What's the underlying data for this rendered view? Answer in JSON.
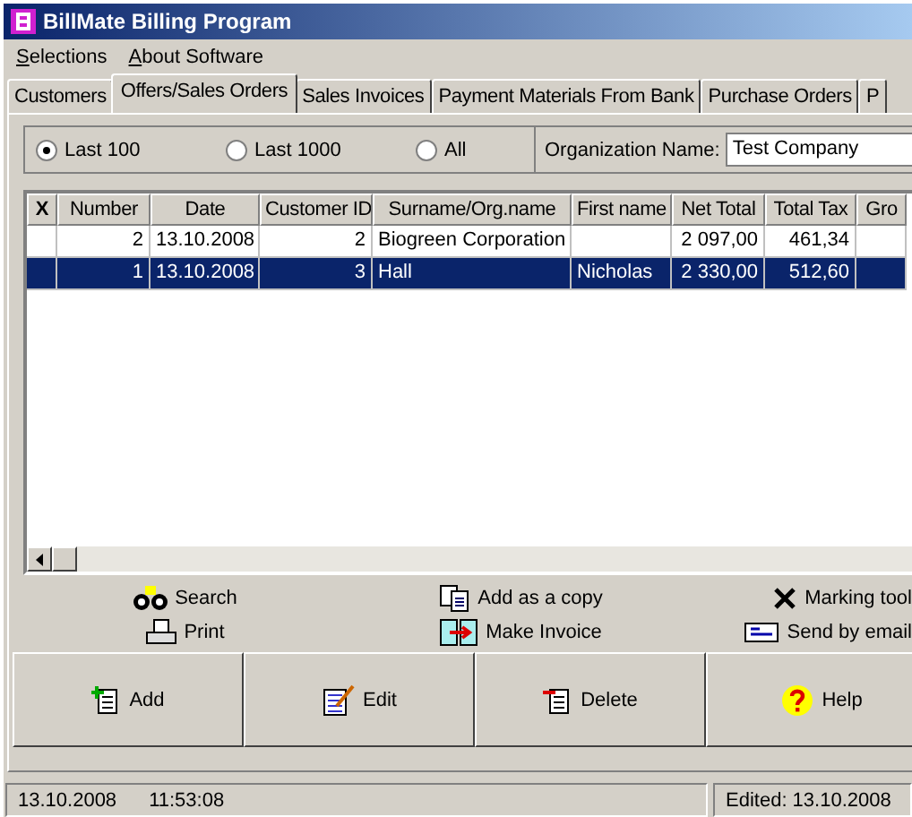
{
  "window": {
    "title": "BillMate Billing Program"
  },
  "menu": [
    {
      "label": "Selections"
    },
    {
      "label": "About Software"
    }
  ],
  "tabs": [
    {
      "label": "Customers",
      "selected": false
    },
    {
      "label": "Offers/Sales Orders",
      "selected": true
    },
    {
      "label": "Sales Invoices",
      "selected": false
    },
    {
      "label": "Payment Materials From Bank",
      "selected": false
    },
    {
      "label": "Purchase Orders",
      "selected": false
    },
    {
      "label": "P",
      "selected": false
    }
  ],
  "filter": {
    "options": [
      {
        "label": "Last 100",
        "selected": true
      },
      {
        "label": "Last 1000",
        "selected": false
      },
      {
        "label": "All",
        "selected": false
      }
    ],
    "org_label": "Organization Name:",
    "org_value": "Test Company"
  },
  "table": {
    "columns": [
      "X",
      "Number",
      "Date",
      "Customer ID",
      "Surname/Org.name",
      "First name",
      "Net Total",
      "Total Tax",
      "Gro"
    ],
    "rows": [
      {
        "selected": false,
        "cells": [
          "",
          "2",
          "13.10.2008",
          "2",
          "Biogreen Corporation",
          "",
          "2 097,00",
          "461,34",
          ""
        ]
      },
      {
        "selected": true,
        "cells": [
          "",
          "1",
          "13.10.2008",
          "3",
          "Hall",
          "Nicholas",
          "2 330,00",
          "512,60",
          ""
        ]
      }
    ]
  },
  "actions": [
    {
      "label": "Search",
      "kind": "search"
    },
    {
      "label": "Add as a copy",
      "kind": "copy"
    },
    {
      "label": "Marking tool",
      "kind": "mark"
    },
    {
      "label": "Print",
      "kind": "print"
    },
    {
      "label": "Make Invoice",
      "kind": "invoice"
    },
    {
      "label": "Send by email",
      "kind": "email"
    }
  ],
  "buttons": [
    {
      "label": "Add",
      "kind": "add"
    },
    {
      "label": "Edit",
      "kind": "edit"
    },
    {
      "label": "Delete",
      "kind": "delete"
    },
    {
      "label": "Help",
      "kind": "help"
    }
  ],
  "status_bar": {
    "date": "13.10.2008",
    "time": "11:53:08",
    "edited": "Edited: 13.10.2008"
  }
}
